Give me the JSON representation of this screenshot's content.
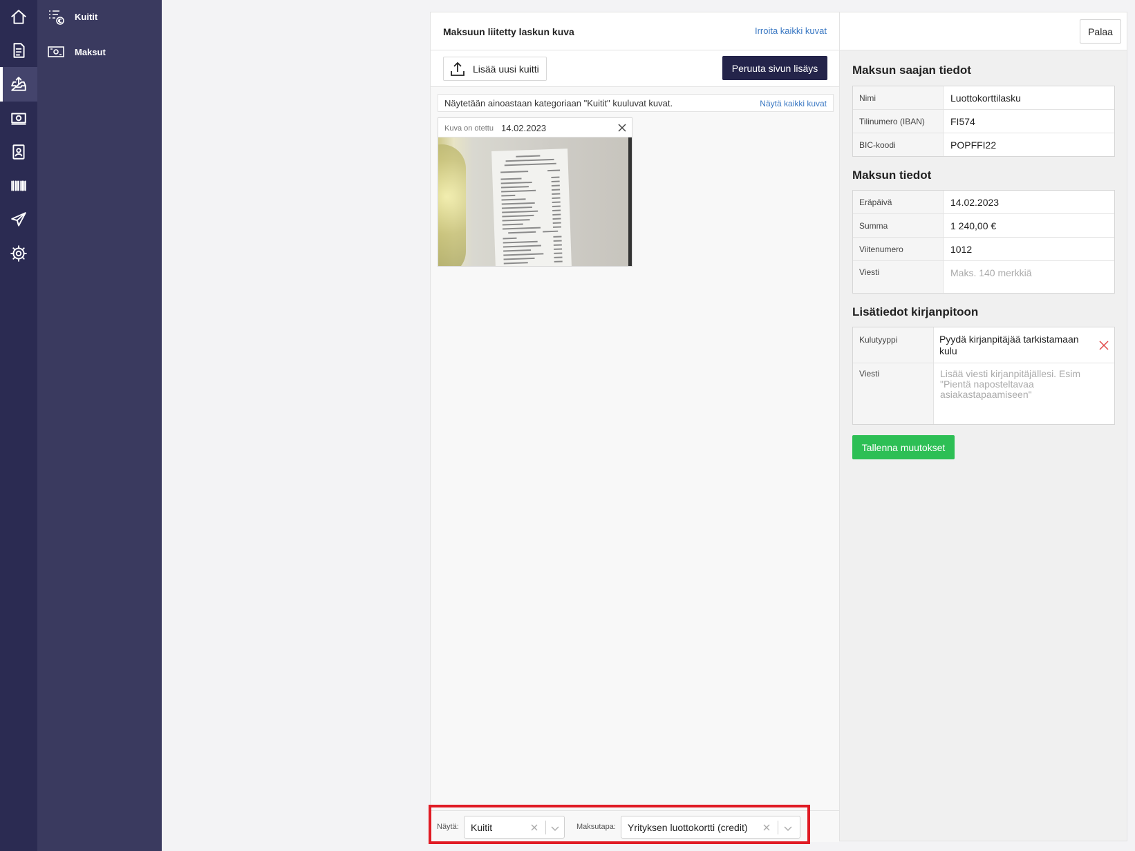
{
  "iconbar": {
    "items": [
      {
        "icon": "home-icon"
      },
      {
        "icon": "invoice-icon"
      },
      {
        "icon": "inbox-upload-icon",
        "active": true
      },
      {
        "icon": "money-icon"
      },
      {
        "icon": "contacts-icon"
      },
      {
        "icon": "barcode-icon"
      },
      {
        "icon": "send-icon"
      },
      {
        "icon": "gear-icon"
      }
    ]
  },
  "subnav": {
    "items": [
      {
        "label": "Kuitit",
        "icon": "receipt-euro-icon"
      },
      {
        "label": "Maksut",
        "icon": "cash-transfer-icon"
      }
    ]
  },
  "center": {
    "title": "Maksuun liitetty laskun kuva",
    "detach_all_link": "Irroita kaikki kuvat",
    "upload_button": "Lisää uusi kuitti",
    "cancel_button": "Peruuta sivun lisäys",
    "filter_note": "Näytetään ainoastaan kategoriaan \"Kuitit\" kuuluvat kuvat.",
    "show_all_link": "Näytä kaikki kuvat",
    "image_card": {
      "taken_label": "Kuva on otettu",
      "date": "14.02.2023"
    },
    "controls": {
      "show_label": "Näytä:",
      "show_value": "Kuitit",
      "payment_label": "Maksutapa:",
      "payment_value": "Yrityksen luottokortti (credit)"
    }
  },
  "right": {
    "back_button": "Palaa",
    "recipient": {
      "title": "Maksun saajan tiedot",
      "rows": [
        {
          "label": "Nimi",
          "value": "Luottokorttilasku"
        },
        {
          "label": "Tilinumero (IBAN)",
          "value": "FI574"
        },
        {
          "label": "BIC-koodi",
          "value": "POPFFI22"
        }
      ]
    },
    "payment": {
      "title": "Maksun tiedot",
      "rows": [
        {
          "label": "Eräpäivä",
          "value": "14.02.2023"
        },
        {
          "label": "Summa",
          "value": "1 240,00 €"
        },
        {
          "label": "Viitenumero",
          "value": "1012"
        },
        {
          "label": "Viesti",
          "placeholder": "Maks. 140 merkkiä"
        }
      ]
    },
    "accounting": {
      "title": "Lisätiedot kirjanpitoon",
      "expense_type_label": "Kulutyyppi",
      "expense_type_value": "Pyydä kirjanpitäjää tarkistamaan kulu",
      "message_label": "Viesti",
      "message_placeholder": "Lisää viesti kirjanpitäjällesi. Esim \"Pientä naposteltavaa asiakastapaamiseen\""
    },
    "save_button": "Tallenna muutokset"
  },
  "colors": {
    "iconbar_bg": "#2b2b52",
    "subnav_bg": "#3a3a5f",
    "primary_dark": "#24244a",
    "link": "#3a78c3",
    "success": "#2dbf55",
    "danger": "#e01b24"
  }
}
